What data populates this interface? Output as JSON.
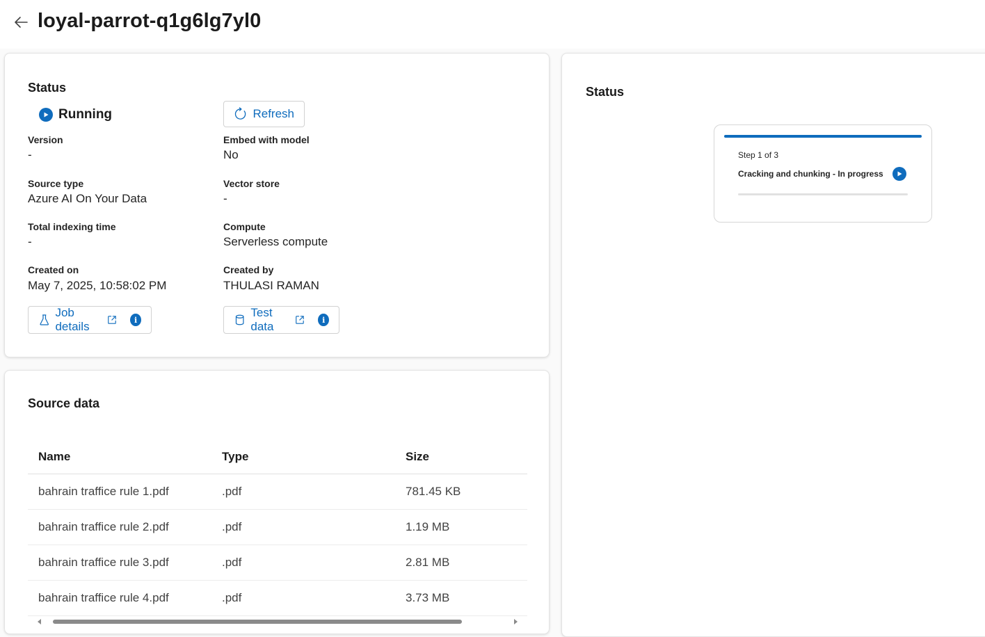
{
  "header": {
    "title": "loyal-parrot-q1g6lg7yl0"
  },
  "status_card": {
    "title": "Status",
    "state_label": "Running",
    "refresh_label": "Refresh",
    "fields": {
      "version": {
        "label": "Version",
        "value": "-"
      },
      "embed_with_model": {
        "label": "Embed with model",
        "value": "No"
      },
      "source_type": {
        "label": "Source type",
        "value": "Azure AI On Your Data"
      },
      "vector_store": {
        "label": "Vector store",
        "value": "-"
      },
      "total_indexing_time": {
        "label": "Total indexing time",
        "value": "-"
      },
      "compute": {
        "label": "Compute",
        "value": "Serverless compute"
      },
      "created_on": {
        "label": "Created on",
        "value": "May 7, 2025, 10:58:02 PM"
      },
      "created_by": {
        "label": "Created by",
        "value": "THULASI RAMAN"
      }
    },
    "job_details_label": "Job details",
    "test_data_label": "Test data",
    "info_glyph": "i"
  },
  "source_card": {
    "title": "Source data",
    "columns": [
      "Name",
      "Type",
      "Size"
    ],
    "rows": [
      [
        "bahrain traffice rule 1.pdf",
        ".pdf",
        "781.45 KB"
      ],
      [
        "bahrain traffice rule 2.pdf",
        ".pdf",
        "1.19 MB"
      ],
      [
        "bahrain traffice rule 3.pdf",
        ".pdf",
        "2.81 MB"
      ],
      [
        "bahrain traffice rule 4.pdf",
        ".pdf",
        "3.73 MB"
      ]
    ]
  },
  "right_panel": {
    "title": "Status",
    "step": {
      "number_label": "Step 1 of 3",
      "description": "Cracking and chunking - In progress"
    }
  },
  "colors": {
    "accent": "#0f6cbd",
    "text": "#242424",
    "border": "#e3e3e3"
  },
  "icons": {
    "back": "arrow-left-icon",
    "running": "play-circle-icon",
    "refresh": "refresh-icon",
    "job_details": "flask-icon",
    "test_data": "database-icon",
    "open_external": "open-external-icon",
    "info": "info-icon",
    "step_status": "play-circle-icon"
  }
}
